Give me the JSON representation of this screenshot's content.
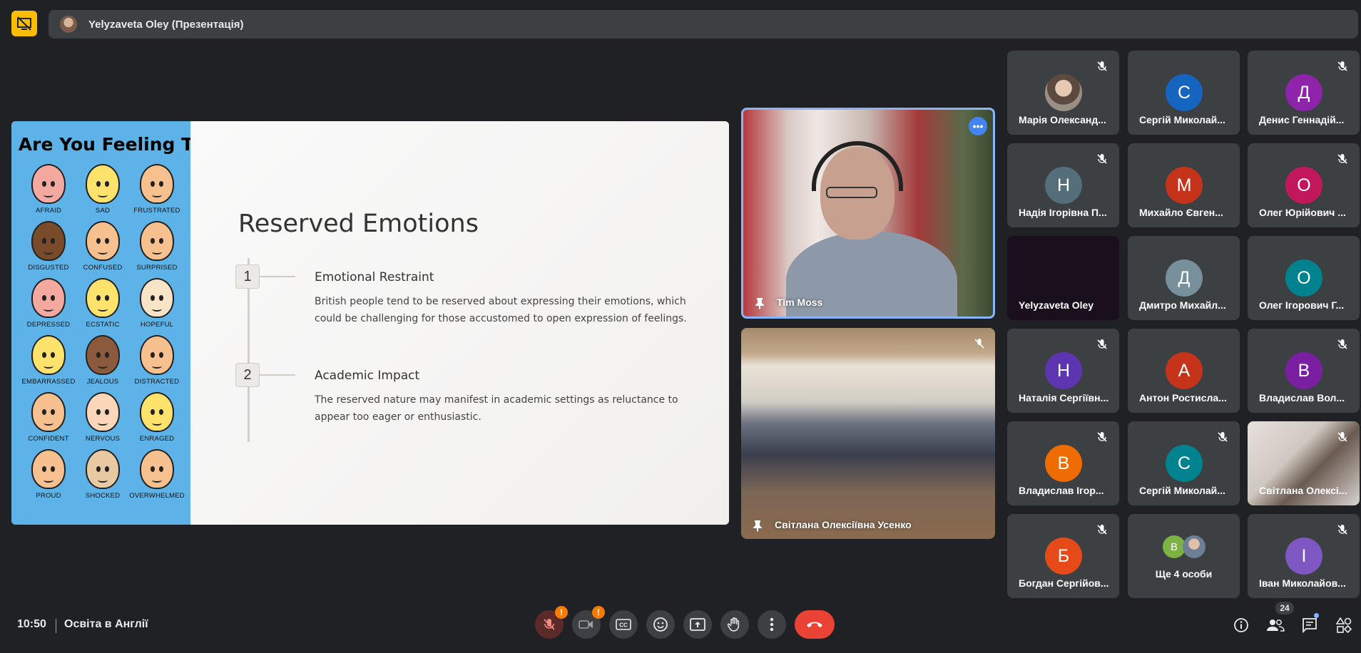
{
  "header": {
    "presenter_banner": "Yelyzaveta Oley (Презентація)"
  },
  "slide": {
    "left_heading": "w Are You Feeling Tod",
    "faces": [
      {
        "label": "AFRAID",
        "color": "#f4a9a0"
      },
      {
        "label": "SAD",
        "color": "#fde36b"
      },
      {
        "label": "FRUSTRATED",
        "color": "#f6c08f"
      },
      {
        "label": "DISGUSTED",
        "color": "#7a4b2a"
      },
      {
        "label": "CONFUSED",
        "color": "#f6c08f"
      },
      {
        "label": "SURPRISED",
        "color": "#f6c08f"
      },
      {
        "label": "DEPRESSED",
        "color": "#f4a9a0"
      },
      {
        "label": "ECSTATIC",
        "color": "#fde36b"
      },
      {
        "label": "HOPEFUL",
        "color": "#f9e4c8"
      },
      {
        "label": "EMBARRASSED",
        "color": "#fde36b"
      },
      {
        "label": "JEALOUS",
        "color": "#8b5a3c"
      },
      {
        "label": "DISTRACTED",
        "color": "#f6c08f"
      },
      {
        "label": "CONFIDENT",
        "color": "#f6c08f"
      },
      {
        "label": "NERVOUS",
        "color": "#fbd6b8"
      },
      {
        "label": "ENRAGED",
        "color": "#fde36b"
      },
      {
        "label": "PROUD",
        "color": "#f6c08f"
      },
      {
        "label": "SHOCKED",
        "color": "#e9c9a2"
      },
      {
        "label": "OVERWHELMED",
        "color": "#f6c08f"
      }
    ],
    "title": "Reserved Emotions",
    "steps": [
      {
        "number": "1",
        "heading": "Emotional Restraint",
        "body": "British people tend to be reserved about expressing their emotions, which could be challenging for those accustomed to open expression of feelings."
      },
      {
        "number": "2",
        "heading": "Academic Impact",
        "body": "The reserved nature may manifest in academic settings as reluctance to appear too eager or enthusiastic."
      }
    ]
  },
  "videos": {
    "pinned_speaker": "Tim Moss",
    "more_options": "•••",
    "classroom": "Світлана Олексіївна Усенко"
  },
  "participants": [
    {
      "name": "Марія Олександ...",
      "initial": "",
      "color": "#8a7f78",
      "muted": true
    },
    {
      "name": "Сергій Миколай...",
      "initial": "С",
      "color": "#1565c0",
      "muted": false
    },
    {
      "name": "Денис Геннадій...",
      "initial": "Д",
      "color": "#8e24aa",
      "muted": true
    },
    {
      "name": "Надія Ігорівна П...",
      "initial": "Н",
      "color": "#546e7a",
      "muted": true
    },
    {
      "name": "Михайло Євген...",
      "initial": "М",
      "color": "#c5331a",
      "muted": false
    },
    {
      "name": "Олег Юрійович ...",
      "initial": "О",
      "color": "#c2185b",
      "muted": true
    },
    {
      "name": "Yelyzaveta Oley",
      "initial": "",
      "color": "#1a0f1c",
      "muted": false
    },
    {
      "name": "Дмитро Михайл...",
      "initial": "Д",
      "color": "#78909c",
      "muted": false
    },
    {
      "name": "Олег Ігорович Г...",
      "initial": "О",
      "color": "#00838f",
      "muted": false
    },
    {
      "name": "Наталія Сергіївн...",
      "initial": "Н",
      "color": "#5e35b1",
      "muted": true
    },
    {
      "name": "Антон Ростисла...",
      "initial": "А",
      "color": "#c5331a",
      "muted": false
    },
    {
      "name": "Владислав Вол...",
      "initial": "В",
      "color": "#7b1fa2",
      "muted": true
    },
    {
      "name": "Владислав Ігор...",
      "initial": "В",
      "color": "#ef6c00",
      "muted": true
    },
    {
      "name": "Сергій Миколай...",
      "initial": "С",
      "color": "#00838f",
      "muted": true
    },
    {
      "name": "Світлана Олексі...",
      "initial": "",
      "color": "#d9d4cf",
      "muted": true
    },
    {
      "name": "Богдан Сергійов...",
      "initial": "Б",
      "color": "#e64a19",
      "muted": true
    },
    {
      "name": "Ще 4 особи",
      "initial": "В",
      "color": "#7cb342",
      "muted": false
    },
    {
      "name": "Іван Миколайов...",
      "initial": "І",
      "color": "#7e57c2",
      "muted": true
    }
  ],
  "footer": {
    "time": "10:50",
    "meeting_title": "Освіта в Англії",
    "mic_badge": "!",
    "cam_badge": "!",
    "people_count": "24"
  }
}
